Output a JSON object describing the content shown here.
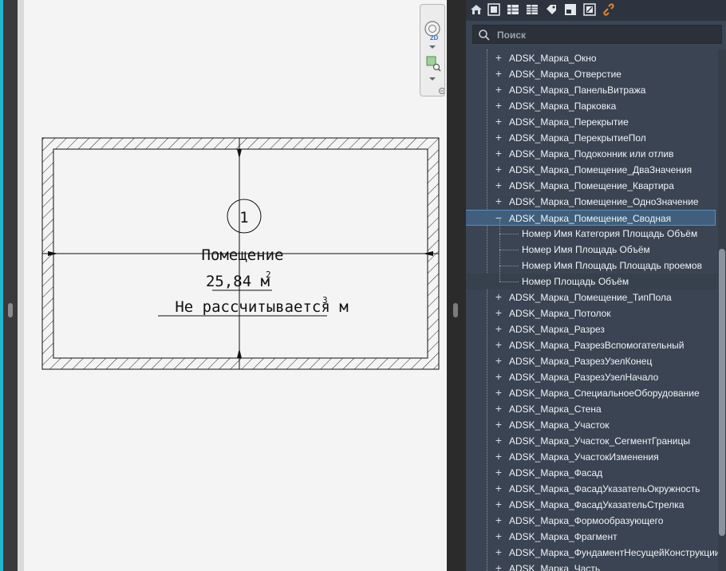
{
  "canvas": {
    "tag_number": "1",
    "room_name": "Помещение",
    "room_area": "25,84 м",
    "area_sup": "2",
    "volume_text": "Не рассчитывается м",
    "volume_sup": "3"
  },
  "view_toolbar": {
    "items": [
      "navigation-wheel-icon",
      "zoom-region-icon"
    ],
    "wheel_badge": "2D"
  },
  "panel": {
    "toolbar_icons": [
      "home-icon",
      "properties-icon",
      "table-icon",
      "grid-icon",
      "tag-icon",
      "layout-icon",
      "edit-icon",
      "link-icon"
    ],
    "search_placeholder": "Поиск",
    "tree": [
      {
        "label": "ADSK_Марка_Окно",
        "type": "collapsed"
      },
      {
        "label": "ADSK_Марка_Отверстие",
        "type": "collapsed"
      },
      {
        "label": "ADSK_Марка_ПанельВитража",
        "type": "collapsed"
      },
      {
        "label": "ADSK_Марка_Парковка",
        "type": "collapsed"
      },
      {
        "label": "ADSK_Марка_Перекрытие",
        "type": "collapsed"
      },
      {
        "label": "ADSK_Марка_ПерекрытиеПол",
        "type": "collapsed"
      },
      {
        "label": "ADSK_Марка_Подоконник или отлив",
        "type": "collapsed"
      },
      {
        "label": "ADSK_Марка_Помещение_ДваЗначения",
        "type": "collapsed"
      },
      {
        "label": "ADSK_Марка_Помещение_Квартира",
        "type": "collapsed"
      },
      {
        "label": "ADSK_Марка_Помещение_ОдноЗначение",
        "type": "collapsed"
      },
      {
        "label": "ADSK_Марка_Помещение_Сводная",
        "type": "expanded",
        "selected": true
      },
      {
        "label": "Номер Имя Категория Площадь Объём",
        "type": "child"
      },
      {
        "label": "Номер Имя Площадь Объём",
        "type": "child"
      },
      {
        "label": "Номер Имя Площадь Площадь проемов",
        "type": "child"
      },
      {
        "label": "Номер Площадь Объём",
        "type": "child",
        "highlighted": true
      },
      {
        "label": "ADSK_Марка_Помещение_ТипПола",
        "type": "collapsed"
      },
      {
        "label": "ADSK_Марка_Потолок",
        "type": "collapsed"
      },
      {
        "label": "ADSK_Марка_Разрез",
        "type": "collapsed"
      },
      {
        "label": "ADSK_Марка_РазрезВспомогательный",
        "type": "collapsed"
      },
      {
        "label": "ADSK_Марка_РазрезУзелКонец",
        "type": "collapsed"
      },
      {
        "label": "ADSK_Марка_РазрезУзелНачало",
        "type": "collapsed"
      },
      {
        "label": "ADSK_Марка_СпециальноеОборудование",
        "type": "collapsed"
      },
      {
        "label": "ADSK_Марка_Стена",
        "type": "collapsed"
      },
      {
        "label": "ADSK_Марка_Участок",
        "type": "collapsed"
      },
      {
        "label": "ADSK_Марка_Участок_СегментГраницы",
        "type": "collapsed"
      },
      {
        "label": "ADSK_Марка_УчастокИзменения",
        "type": "collapsed"
      },
      {
        "label": "ADSK_Марка_Фасад",
        "type": "collapsed"
      },
      {
        "label": "ADSK_Марка_ФасадУказательОкружность",
        "type": "collapsed"
      },
      {
        "label": "ADSK_Марка_ФасадУказательСтрелка",
        "type": "collapsed"
      },
      {
        "label": "ADSK_Марка_Формообразующего",
        "type": "collapsed"
      },
      {
        "label": "ADSK_Марка_Фрагмент",
        "type": "collapsed"
      },
      {
        "label": "ADSK_Марка_ФундаментНесущейКонструкции",
        "type": "collapsed"
      },
      {
        "label": "ADSK_Марка_Часть",
        "type": "collapsed"
      }
    ]
  },
  "colors": {
    "panel_bg": "#3b4453",
    "selection": "#3f5f7d",
    "accent_cyan": "#1fb8cf",
    "canvas_bg": "#f4f4f4"
  }
}
